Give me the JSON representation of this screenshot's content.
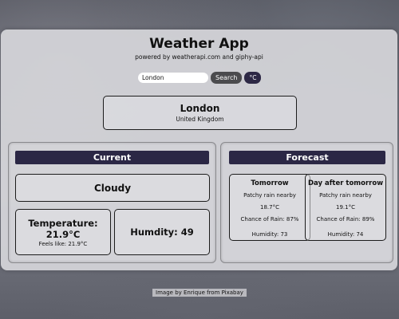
{
  "header": {
    "title": "Weather App",
    "subtitle": "powered by weatherapi.com and giphy-api"
  },
  "search": {
    "value": "London",
    "button_label": "Search",
    "unit_label": "°C"
  },
  "location": {
    "city": "London",
    "country": "United Kingdom"
  },
  "current": {
    "heading": "Current",
    "condition": "Cloudy",
    "temperature_label": "Temperature:",
    "temperature_value": "21.9°C",
    "feels_like": "Feels like: 21.9°C",
    "humidity": "Humdity: 49"
  },
  "forecast": {
    "heading": "Forecast",
    "days": [
      {
        "day": "Tomorrow",
        "condition": "Patchy rain nearby",
        "temperature": "18.7°C",
        "rain_chance": "Chance of Rain: 87%",
        "humidity": "Humidity: 73"
      },
      {
        "day": "Day after tomorrow",
        "condition": "Patchy rain nearby",
        "temperature": "19.1°C",
        "rain_chance": "Chance of Rain: 89%",
        "humidity": "Humidity: 74"
      }
    ]
  },
  "footer": {
    "credit": "Image by Enrique from Pixabay"
  },
  "colors": {
    "accent": "#2b2745",
    "search_button": "#4b4b4e",
    "card_background": "#d6d6da"
  }
}
